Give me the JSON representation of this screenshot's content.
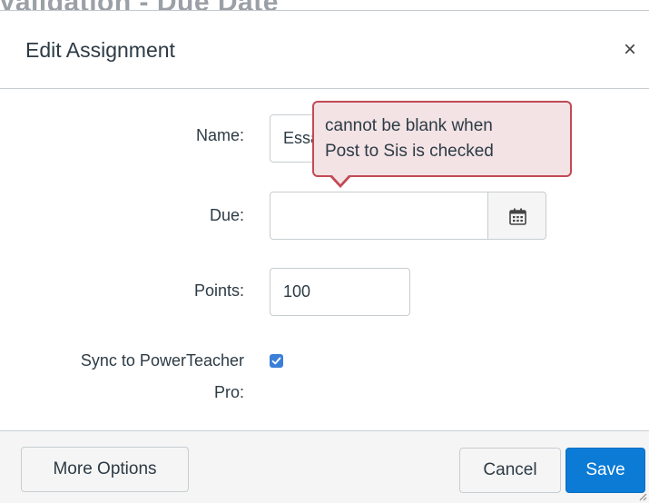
{
  "background": {
    "title": "Validation - Due Date"
  },
  "dialog": {
    "title": "Edit Assignment",
    "close_symbol": "×"
  },
  "form": {
    "name_label": "Name:",
    "name_value": "Essay",
    "due_label": "Due:",
    "due_value": "",
    "calendar_icon": "calendar-icon",
    "points_label": "Points:",
    "points_value": "100",
    "sync_label_line1": "Sync to PowerTeacher",
    "sync_label_line2": "Pro:",
    "sync_checked": true
  },
  "tooltip": {
    "line1": "cannot be blank when",
    "line2": "Post to Sis is checked"
  },
  "footer": {
    "more_options_label": "More Options",
    "cancel_label": "Cancel",
    "save_label": "Save"
  },
  "colors": {
    "primary": "#0b7bd6",
    "error_border": "#c24a55",
    "error_bg": "#f3e3e5",
    "checkbox": "#3b7fd9"
  }
}
